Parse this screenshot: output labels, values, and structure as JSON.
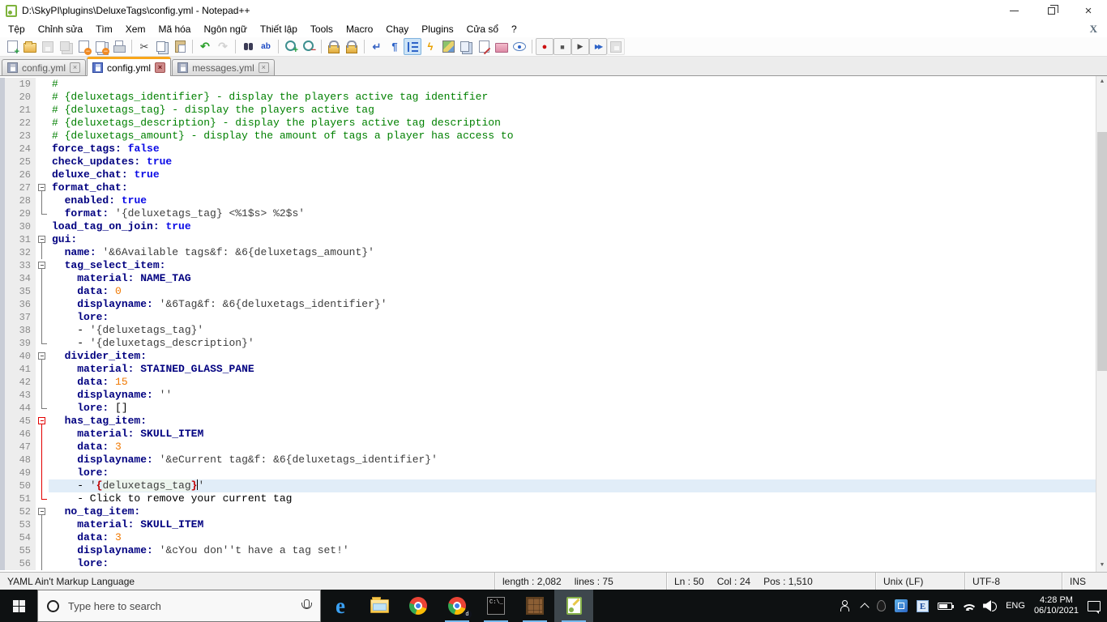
{
  "window": {
    "title": "D:\\SkyPI\\plugins\\DeluxeTags\\config.yml - Notepad++"
  },
  "menu": {
    "items": [
      {
        "id": "tep",
        "label": "Tệp"
      },
      {
        "id": "chinh-sua",
        "label": "Chỉnh sửa"
      },
      {
        "id": "tim",
        "label": "Tìm"
      },
      {
        "id": "xem",
        "label": "Xem"
      },
      {
        "id": "ma-hoa",
        "label": "Mã hóa"
      },
      {
        "id": "ngon-ngu",
        "label": "Ngôn ngữ"
      },
      {
        "id": "thiet-lap",
        "label": "Thiết lập"
      },
      {
        "id": "tools",
        "label": "Tools"
      },
      {
        "id": "macro",
        "label": "Macro"
      },
      {
        "id": "chay",
        "label": "Chạy"
      },
      {
        "id": "plugins",
        "label": "Plugins"
      },
      {
        "id": "cua-so",
        "label": "Cửa sổ"
      },
      {
        "id": "help",
        "label": "?"
      }
    ],
    "close_x": "X"
  },
  "toolbar": {
    "items": [
      {
        "name": "new-file-icon",
        "k": "pagenew"
      },
      {
        "name": "open-folder-icon",
        "k": "folder"
      },
      {
        "name": "save-icon",
        "k": "disk",
        "d": 1
      },
      {
        "name": "save-all-icon",
        "k": "diskall",
        "d": 1
      },
      {
        "name": "close-doc-icon",
        "k": "pageclose"
      },
      {
        "name": "close-all-docs-icon",
        "k": "pagesclose"
      },
      {
        "name": "print-icon",
        "k": "printer"
      },
      {
        "sep": 1
      },
      {
        "name": "cut-icon",
        "k": "cut"
      },
      {
        "name": "copy-icon",
        "k": "copy"
      },
      {
        "name": "paste-icon",
        "k": "paste"
      },
      {
        "sep": 1
      },
      {
        "name": "undo-icon",
        "k": "undo"
      },
      {
        "name": "redo-icon",
        "k": "redo",
        "d": 1
      },
      {
        "sep": 1
      },
      {
        "name": "find-icon",
        "k": "find"
      },
      {
        "name": "replace-icon",
        "k": "replace"
      },
      {
        "sep": 1
      },
      {
        "name": "zoom-in-icon",
        "k": "zin"
      },
      {
        "name": "zoom-out-icon",
        "k": "zout"
      },
      {
        "sep": 1
      },
      {
        "name": "sync-vertical-scroll-icon",
        "k": "lock"
      },
      {
        "name": "sync-horizontal-scroll-icon",
        "k": "lock"
      },
      {
        "sep": 1
      },
      {
        "name": "word-wrap-icon",
        "k": "wrap"
      },
      {
        "name": "show-all-characters-icon",
        "k": "pilcrow"
      },
      {
        "name": "indent-guide-icon",
        "k": "indent",
        "a": 1
      },
      {
        "name": "user-defined-language-icon",
        "k": "lightning"
      },
      {
        "name": "document-map-icon",
        "k": "map"
      },
      {
        "name": "document-switcher-icon",
        "k": "pages"
      },
      {
        "name": "edit-macro-icon",
        "k": "pen"
      },
      {
        "name": "project-panel-icon",
        "k": "folderp"
      },
      {
        "name": "preview-eye-icon",
        "k": "eye"
      },
      {
        "sep": 1
      },
      {
        "name": "record-macro-icon",
        "k": "rec"
      },
      {
        "name": "stop-record-icon",
        "k": "stop"
      },
      {
        "name": "playback-macro-icon",
        "k": "play"
      },
      {
        "name": "run-macro-multiple-icon",
        "k": "ffwd"
      },
      {
        "name": "save-recorded-macro-icon",
        "k": "msave",
        "d": 1
      }
    ]
  },
  "tabs": [
    {
      "name": "tab-config-yml-1",
      "label": "config.yml",
      "active": false
    },
    {
      "name": "tab-config-yml-2",
      "label": "config.yml",
      "active": true
    },
    {
      "name": "tab-messages-yml",
      "label": "messages.yml",
      "active": false
    }
  ],
  "editor": {
    "lines": [
      {
        "n": 19,
        "f": "",
        "s": [
          [
            "cm",
            "#"
          ]
        ]
      },
      {
        "n": 20,
        "f": "",
        "s": [
          [
            "cm",
            "# {deluxetags_identifier} - display the players active tag identifier"
          ]
        ]
      },
      {
        "n": 21,
        "f": "",
        "s": [
          [
            "cm",
            "# {deluxetags_tag} - display the players active tag"
          ]
        ]
      },
      {
        "n": 22,
        "f": "",
        "s": [
          [
            "cm",
            "# {deluxetags_description} - display the players active tag description"
          ]
        ]
      },
      {
        "n": 23,
        "f": "",
        "s": [
          [
            "cm",
            "# {deluxetags_amount} - display the amount of tags a player has access to"
          ]
        ]
      },
      {
        "n": 24,
        "f": "",
        "s": [
          [
            "k",
            "force_tags:"
          ],
          [
            "p",
            " "
          ],
          [
            "v",
            "false"
          ]
        ]
      },
      {
        "n": 25,
        "f": "",
        "s": [
          [
            "k",
            "check_updates:"
          ],
          [
            "p",
            " "
          ],
          [
            "v",
            "true"
          ]
        ]
      },
      {
        "n": 26,
        "f": "",
        "s": [
          [
            "k",
            "deluxe_chat:"
          ],
          [
            "p",
            " "
          ],
          [
            "v",
            "true"
          ]
        ]
      },
      {
        "n": 27,
        "f": "box",
        "s": [
          [
            "k",
            "format_chat:"
          ]
        ]
      },
      {
        "n": 28,
        "f": "line",
        "s": [
          [
            "p",
            "  "
          ],
          [
            "k",
            "enabled:"
          ],
          [
            "p",
            " "
          ],
          [
            "v",
            "true"
          ]
        ]
      },
      {
        "n": 29,
        "f": "end",
        "s": [
          [
            "p",
            "  "
          ],
          [
            "k",
            "format:"
          ],
          [
            "p",
            " "
          ],
          [
            "s",
            "'{deluxetags_tag} <%1$s> %2$s'"
          ]
        ]
      },
      {
        "n": 30,
        "f": "",
        "s": [
          [
            "k",
            "load_tag_on_join:"
          ],
          [
            "p",
            " "
          ],
          [
            "v",
            "true"
          ]
        ]
      },
      {
        "n": 31,
        "f": "box",
        "s": [
          [
            "k",
            "gui:"
          ]
        ]
      },
      {
        "n": 32,
        "f": "line",
        "s": [
          [
            "p",
            "  "
          ],
          [
            "k",
            "name:"
          ],
          [
            "p",
            " "
          ],
          [
            "s",
            "'&6Available tags&f: &6{deluxetags_amount}'"
          ]
        ]
      },
      {
        "n": 33,
        "f": "box",
        "s": [
          [
            "p",
            "  "
          ],
          [
            "k",
            "tag_select_item:"
          ]
        ]
      },
      {
        "n": 34,
        "f": "line",
        "s": [
          [
            "p",
            "    "
          ],
          [
            "k",
            "material:"
          ],
          [
            "p",
            " "
          ],
          [
            "k",
            "NAME_TAG"
          ]
        ]
      },
      {
        "n": 35,
        "f": "line",
        "s": [
          [
            "p",
            "    "
          ],
          [
            "k",
            "data:"
          ],
          [
            "p",
            " "
          ],
          [
            "n",
            "0"
          ]
        ]
      },
      {
        "n": 36,
        "f": "line",
        "s": [
          [
            "p",
            "    "
          ],
          [
            "k",
            "displayname:"
          ],
          [
            "p",
            " "
          ],
          [
            "s",
            "'&6Tag&f: &6{deluxetags_identifier}'"
          ]
        ]
      },
      {
        "n": 37,
        "f": "line",
        "s": [
          [
            "p",
            "    "
          ],
          [
            "k",
            "lore:"
          ]
        ]
      },
      {
        "n": 38,
        "f": "line",
        "s": [
          [
            "p",
            "    - "
          ],
          [
            "s",
            "'{deluxetags_tag}'"
          ]
        ]
      },
      {
        "n": 39,
        "f": "end",
        "s": [
          [
            "p",
            "    - "
          ],
          [
            "s",
            "'{deluxetags_description}'"
          ]
        ]
      },
      {
        "n": 40,
        "f": "box",
        "s": [
          [
            "p",
            "  "
          ],
          [
            "k",
            "divider_item:"
          ]
        ]
      },
      {
        "n": 41,
        "f": "line",
        "s": [
          [
            "p",
            "    "
          ],
          [
            "k",
            "material:"
          ],
          [
            "p",
            " "
          ],
          [
            "k",
            "STAINED_GLASS_PANE"
          ]
        ]
      },
      {
        "n": 42,
        "f": "line",
        "s": [
          [
            "p",
            "    "
          ],
          [
            "k",
            "data:"
          ],
          [
            "p",
            " "
          ],
          [
            "n",
            "15"
          ]
        ]
      },
      {
        "n": 43,
        "f": "line",
        "s": [
          [
            "p",
            "    "
          ],
          [
            "k",
            "displayname:"
          ],
          [
            "p",
            " "
          ],
          [
            "s",
            "''"
          ]
        ]
      },
      {
        "n": 44,
        "f": "end",
        "s": [
          [
            "p",
            "    "
          ],
          [
            "k",
            "lore:"
          ],
          [
            "p",
            " []"
          ]
        ]
      },
      {
        "n": 45,
        "f": "boxr",
        "s": [
          [
            "p",
            "  "
          ],
          [
            "k",
            "has_tag_item:"
          ]
        ]
      },
      {
        "n": 46,
        "f": "liner",
        "s": [
          [
            "p",
            "    "
          ],
          [
            "k",
            "material:"
          ],
          [
            "p",
            " "
          ],
          [
            "k",
            "SKULL_ITEM"
          ]
        ]
      },
      {
        "n": 47,
        "f": "liner",
        "s": [
          [
            "p",
            "    "
          ],
          [
            "k",
            "data:"
          ],
          [
            "p",
            " "
          ],
          [
            "n",
            "3"
          ]
        ]
      },
      {
        "n": 48,
        "f": "liner",
        "s": [
          [
            "p",
            "    "
          ],
          [
            "k",
            "displayname:"
          ],
          [
            "p",
            " "
          ],
          [
            "s",
            "'&eCurrent tag&f: &6{deluxetags_identifier}'"
          ]
        ]
      },
      {
        "n": 49,
        "f": "liner",
        "s": [
          [
            "p",
            "    "
          ],
          [
            "k",
            "lore:"
          ]
        ]
      },
      {
        "n": 50,
        "f": "liner",
        "cur": true,
        "s": [
          [
            "p",
            "    - "
          ],
          [
            "s",
            "'"
          ],
          [
            "b",
            "{"
          ],
          [
            "sh",
            "deluxetags_tag"
          ],
          [
            "b",
            "}"
          ],
          [
            "caret",
            ""
          ],
          [
            "s",
            "'"
          ]
        ]
      },
      {
        "n": 51,
        "f": "endr",
        "s": [
          [
            "p",
            "    - Click to remove your current tag"
          ]
        ]
      },
      {
        "n": 52,
        "f": "box",
        "s": [
          [
            "p",
            "  "
          ],
          [
            "k",
            "no_tag_item:"
          ]
        ]
      },
      {
        "n": 53,
        "f": "line",
        "s": [
          [
            "p",
            "    "
          ],
          [
            "k",
            "material:"
          ],
          [
            "p",
            " "
          ],
          [
            "k",
            "SKULL_ITEM"
          ]
        ]
      },
      {
        "n": 54,
        "f": "line",
        "s": [
          [
            "p",
            "    "
          ],
          [
            "k",
            "data:"
          ],
          [
            "p",
            " "
          ],
          [
            "n",
            "3"
          ]
        ]
      },
      {
        "n": 55,
        "f": "line",
        "s": [
          [
            "p",
            "    "
          ],
          [
            "k",
            "displayname:"
          ],
          [
            "p",
            " "
          ],
          [
            "s",
            "'&cYou don''t have a tag set!'"
          ]
        ]
      },
      {
        "n": 56,
        "f": "line",
        "s": [
          [
            "p",
            "    "
          ],
          [
            "k",
            "lore:"
          ]
        ]
      }
    ]
  },
  "status": {
    "lang": "YAML Ain't Markup Language",
    "length": "length : 2,082",
    "lines": "lines : 75",
    "ln": "Ln : 50",
    "col": "Col : 24",
    "pos": "Pos : 1,510",
    "eol": "Unix (LF)",
    "encoding": "UTF-8",
    "mode": "INS"
  },
  "taskbar": {
    "search_placeholder": "Type here to search",
    "apps": [
      {
        "name": "taskbar-edge-icon",
        "k": "edge",
        "running": false,
        "active": false
      },
      {
        "name": "taskbar-explorer-icon",
        "k": "explorer",
        "running": false,
        "active": false
      },
      {
        "name": "taskbar-chrome-icon",
        "k": "chrome",
        "running": false,
        "active": false
      },
      {
        "name": "taskbar-chrome-profile-icon",
        "k": "chrome2",
        "running": true,
        "active": false
      },
      {
        "name": "taskbar-cmd-icon",
        "k": "cmd",
        "running": true,
        "active": false
      },
      {
        "name": "taskbar-minecraft-icon",
        "k": "mc",
        "running": true,
        "active": false
      },
      {
        "name": "taskbar-notepadpp-icon",
        "k": "npp",
        "running": true,
        "active": true
      }
    ],
    "tray": {
      "icons": [
        {
          "name": "tray-people-icon",
          "k": "people"
        },
        {
          "name": "tray-chevron-up-icon",
          "k": "chev"
        },
        {
          "name": "tray-mouse-icon",
          "k": "mouse"
        },
        {
          "name": "tray-blue-app-icon",
          "k": "bluebox"
        },
        {
          "name": "tray-e-app-icon",
          "k": "eicon"
        },
        {
          "name": "tray-battery-icon",
          "k": "battery"
        },
        {
          "name": "tray-wifi-icon",
          "k": "wifi"
        },
        {
          "name": "tray-volume-icon",
          "k": "vol"
        }
      ],
      "language": "ENG",
      "time": "4:28 PM",
      "date": "06/10/2021"
    }
  },
  "colors": {
    "active_tab_accent": "#F9A61A",
    "current_line_bg": "#E1EDF8",
    "comment": "#008000",
    "key": "#000080",
    "keyword": "#0A0AE6",
    "number": "#F07800",
    "fold_active": "#E30000",
    "taskbar_underline": "#76B9ED"
  }
}
